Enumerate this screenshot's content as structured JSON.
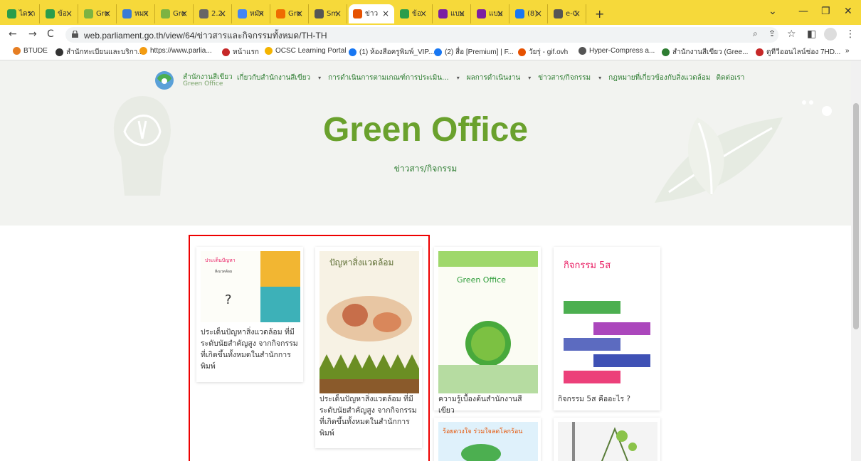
{
  "browser": {
    "tabs": [
      {
        "label": "ไดรา",
        "color": "#2a9d4b"
      },
      {
        "label": "ข้อ",
        "color": "#2a9d4b"
      },
      {
        "label": "Gre",
        "color": "#7cb342"
      },
      {
        "label": "หมา",
        "color": "#3a7bd5"
      },
      {
        "label": "Gre",
        "color": "#7cb342"
      },
      {
        "label": "2.2.",
        "color": "#666"
      },
      {
        "label": "หมัก",
        "color": "#4285f4"
      },
      {
        "label": "Gre",
        "color": "#ef6c00"
      },
      {
        "label": "Sm",
        "color": "#555"
      },
      {
        "label": "ข่าว",
        "color": "#e65100"
      },
      {
        "label": "ข้อ",
        "color": "#2a9d4b"
      },
      {
        "label": "แบบ",
        "color": "#7b1fa2"
      },
      {
        "label": "แบบ",
        "color": "#7b1fa2"
      },
      {
        "label": "(8)",
        "color": "#1877f2"
      },
      {
        "label": "e-C",
        "color": "#555"
      }
    ],
    "new_tab_label": "+",
    "url": "web.parliament.go.th/view/64/ข่าวสารและกิจกรรมทั้งหมด/TH-TH",
    "bookmarks": [
      {
        "label": "BTUDE",
        "color": "#e67e22"
      },
      {
        "label": "สำนักทะเบียนและบริกา...",
        "color": "#333"
      },
      {
        "label": "https://www.parlia...",
        "color": "#f39c12"
      },
      {
        "label": "หน้าแรก",
        "color": "#c62828"
      },
      {
        "label": "OCSC Learning Portal",
        "color": "#f4b400"
      },
      {
        "label": "(1) ห้องสือครูพิมพ์_VIP...",
        "color": "#1877f2"
      },
      {
        "label": "(2) สื่อ [Premium] | F...",
        "color": "#1877f2"
      },
      {
        "label": "วัยรุ่ - gif.ovh",
        "color": "#e65100"
      },
      {
        "label": "Hyper-Compress a...",
        "color": "#555"
      },
      {
        "label": "สำนักงานสีเขียว (Gree...",
        "color": "#2e7d32"
      },
      {
        "label": "ดูทีวีออนไลน์ช่อง 7HD...",
        "color": "#c62828"
      }
    ],
    "bookmarks_more": "»"
  },
  "site": {
    "logo_line1": "สำนักงานสีเขียว",
    "logo_line2": "Green Office",
    "menu": [
      {
        "label": "เกี่ยวกับสำนักงานสีเขียว",
        "dropdown": true
      },
      {
        "label": "การดำเนินการตามเกณฑ์การประเมิน...",
        "dropdown": true
      },
      {
        "label": "ผลการดำเนินงาน",
        "dropdown": true
      },
      {
        "label": "ข่าวสาร/กิจกรรม",
        "dropdown": true
      },
      {
        "label": "กฎหมายที่เกี่ยวข้องกับสิ่งแวดล้อม",
        "dropdown": false
      },
      {
        "label": "ติดต่อเรา",
        "dropdown": false
      }
    ],
    "hero_title": "Green Office",
    "hero_subtitle": "ข่าวสาร/กิจกรรม"
  },
  "cards": [
    {
      "title": "ประเด็นปัญหาสิ่งแวดล้อม ที่มีระดับนัยสำคัญสูง จากกิจกรรมที่เกิดขึ้นทั้งหมดในสำนักการพิมพ์",
      "poster_text": "ประเด็นปัญหา"
    },
    {
      "title": "ประเด็นปัญหาสิ่งแวดล้อม ที่มีระดับนัยสำคัญสูง จากกิจกรรมที่เกิดขึ้นทั้งหมดในสำนักการพิมพ์",
      "poster_text": "ปัญหาสิ่งแวดล้อม"
    },
    {
      "title": "ความรู้เบื้องต้นสำนักงานสีเขียว",
      "poster_text": "Green Office"
    },
    {
      "title": "กิจกรรม 5ส คืออะไร ?",
      "poster_text": "กิจกรรม 5ส"
    },
    {
      "title": "",
      "poster_text": "ร้อยดวงใจ ร่วมใจลดโลกร้อน"
    },
    {
      "title": "",
      "poster_text": ""
    }
  ]
}
